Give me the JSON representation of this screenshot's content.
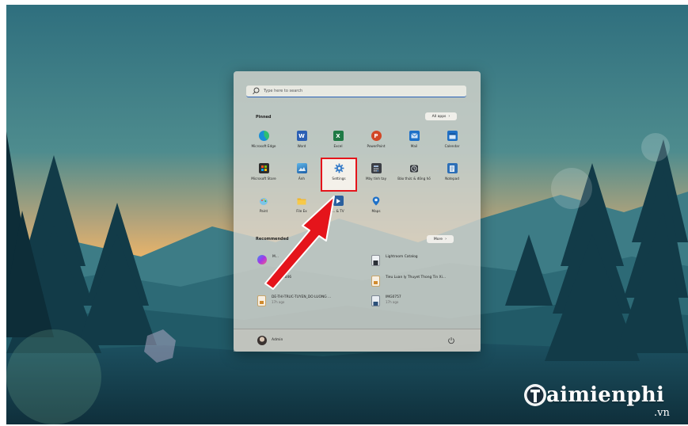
{
  "search": {
    "placeholder": "Type here to search"
  },
  "pinned": {
    "label": "Pinned",
    "all_apps_label": "All apps",
    "apps": [
      {
        "label": "Microsoft Edge",
        "icon": "edge-icon"
      },
      {
        "label": "Word",
        "icon": "word-icon"
      },
      {
        "label": "Excel",
        "icon": "excel-icon"
      },
      {
        "label": "PowerPoint",
        "icon": "powerpoint-icon"
      },
      {
        "label": "Mail",
        "icon": "mail-icon"
      },
      {
        "label": "Calendar",
        "icon": "calendar-icon"
      },
      {
        "label": "Microsoft Store",
        "icon": "store-icon"
      },
      {
        "label": "Ảnh",
        "icon": "photos-icon"
      },
      {
        "label": "Settings",
        "icon": "gear-icon"
      },
      {
        "label": "Máy tính tay",
        "icon": "calculator-icon"
      },
      {
        "label": "Báo thức & đồng hồ",
        "icon": "alarm-clock-icon"
      },
      {
        "label": "Notepad",
        "icon": "notepad-icon"
      },
      {
        "label": "Paint",
        "icon": "paint-icon"
      },
      {
        "label": "File Ex",
        "icon": "file-explorer-icon"
      },
      {
        "label": "... & TV",
        "icon": "movies-tv-icon"
      },
      {
        "label": "Maps",
        "icon": "maps-icon"
      }
    ]
  },
  "recommended": {
    "label": "Recommended",
    "more_label": "More",
    "items": [
      {
        "name": "M...",
        "time": "",
        "icon": "messenger-icon"
      },
      {
        "name": "Lightroom Catalog",
        "time": "",
        "icon": "file-icon"
      },
      {
        "name": "...0C00046",
        "time": "",
        "icon": "file-icon"
      },
      {
        "name": "Tieu Luan ly Thuyet Thong Tin Xi...",
        "time": "",
        "icon": "document-icon"
      },
      {
        "name": "DE-THI-TRUC-TUYEN_DO LUONG ...",
        "time": "17h ago",
        "icon": "document-icon"
      },
      {
        "name": "IMG0757",
        "time": "17h ago",
        "icon": "image-file-icon"
      }
    ]
  },
  "footer": {
    "user_name": "Admin"
  },
  "watermark": {
    "brand": "aimienphi",
    "tld": ".vn"
  },
  "colors": {
    "highlight": "#e5141b",
    "arrow": "#e5141b",
    "accent": "#2a62b8"
  }
}
